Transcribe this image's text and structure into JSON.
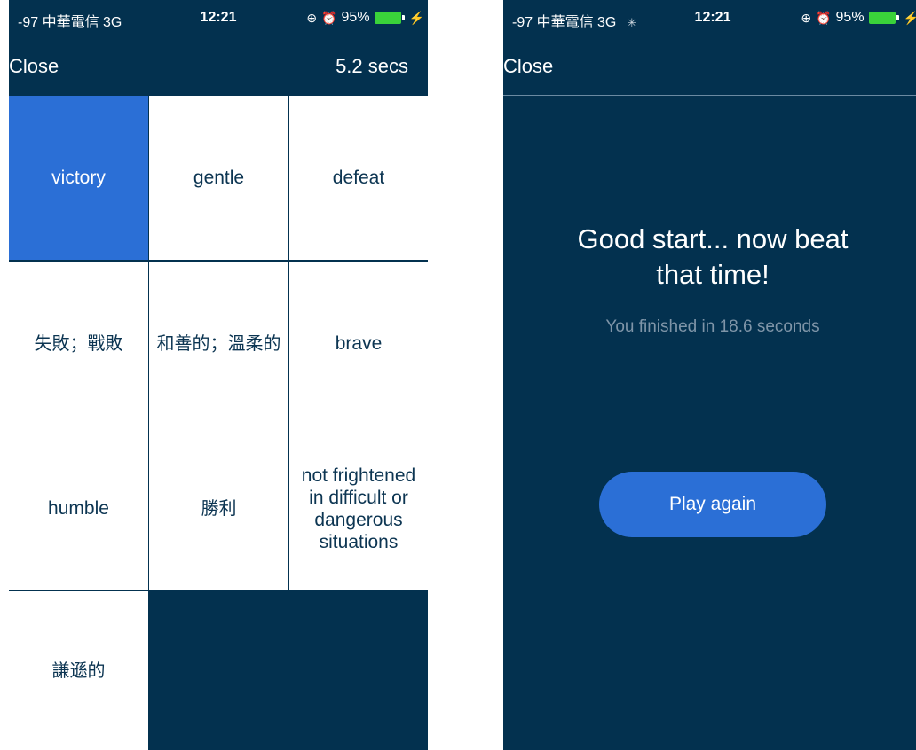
{
  "left_screen": {
    "status": {
      "carrier": "-97 中華電信  3G",
      "time": "12:21",
      "battery": "95%"
    },
    "nav": {
      "close": "Close",
      "timer": "5.2 secs"
    },
    "tiles": [
      [
        "victory",
        "gentle",
        "defeat"
      ],
      [
        "失敗；戰敗",
        "和善的；溫柔的",
        "brave"
      ],
      [
        "humble",
        "勝利",
        "not frightened in difficult or dangerous situations"
      ],
      [
        "謙遜的"
      ]
    ],
    "selected_tile": "victory"
  },
  "right_screen": {
    "status": {
      "carrier": "-97 中華電信  3G",
      "time": "12:21",
      "battery": "95%"
    },
    "nav": {
      "close": "Close"
    },
    "headline": "Good start... now beat that time!",
    "subline": "You finished in 18.6 seconds",
    "play_again": "Play again"
  },
  "colors": {
    "navy": "#03314f",
    "selected_blue": "#2b6fd6",
    "tile_text": "#0c3552",
    "muted_text": "#7f95a8",
    "battery_green": "#3ad23a"
  },
  "icons": [
    "lock-rotation-icon",
    "alarm-icon",
    "battery-icon",
    "charging-bolt-icon",
    "activity-spinner-icon"
  ]
}
